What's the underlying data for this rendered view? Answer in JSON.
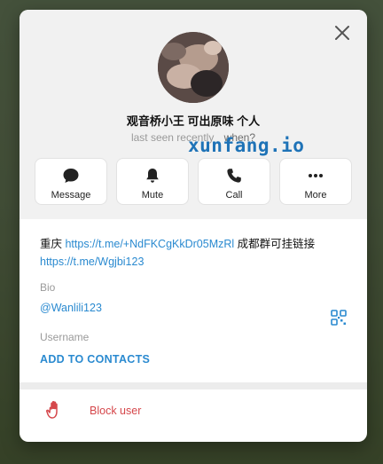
{
  "profile": {
    "name": "观音桥小王 可出原味 个人",
    "status": "last seen recently",
    "status_overlay": "when?",
    "watermark": "xunfang.io"
  },
  "actions": [
    {
      "label": "Message",
      "icon": "message-bubble-icon"
    },
    {
      "label": "Mute",
      "icon": "bell-icon"
    },
    {
      "label": "Call",
      "icon": "phone-icon"
    },
    {
      "label": "More",
      "icon": "more-dots-icon"
    }
  ],
  "bio": {
    "prefix": "重庆 ",
    "link1": "https://t.me/+NdFKCgKkDr05MzRl",
    "middle": " 成都群可挂链接",
    "link2": "https://t.me/Wgjbi123",
    "label": "Bio"
  },
  "username": {
    "value": "@Wanlili123",
    "label": "Username"
  },
  "add_contacts": "ADD TO CONTACTS",
  "block": {
    "label": "Block user"
  },
  "colors": {
    "accent": "#2a8ad0",
    "danger": "#d5474b",
    "watermark": "#1f73b7"
  }
}
